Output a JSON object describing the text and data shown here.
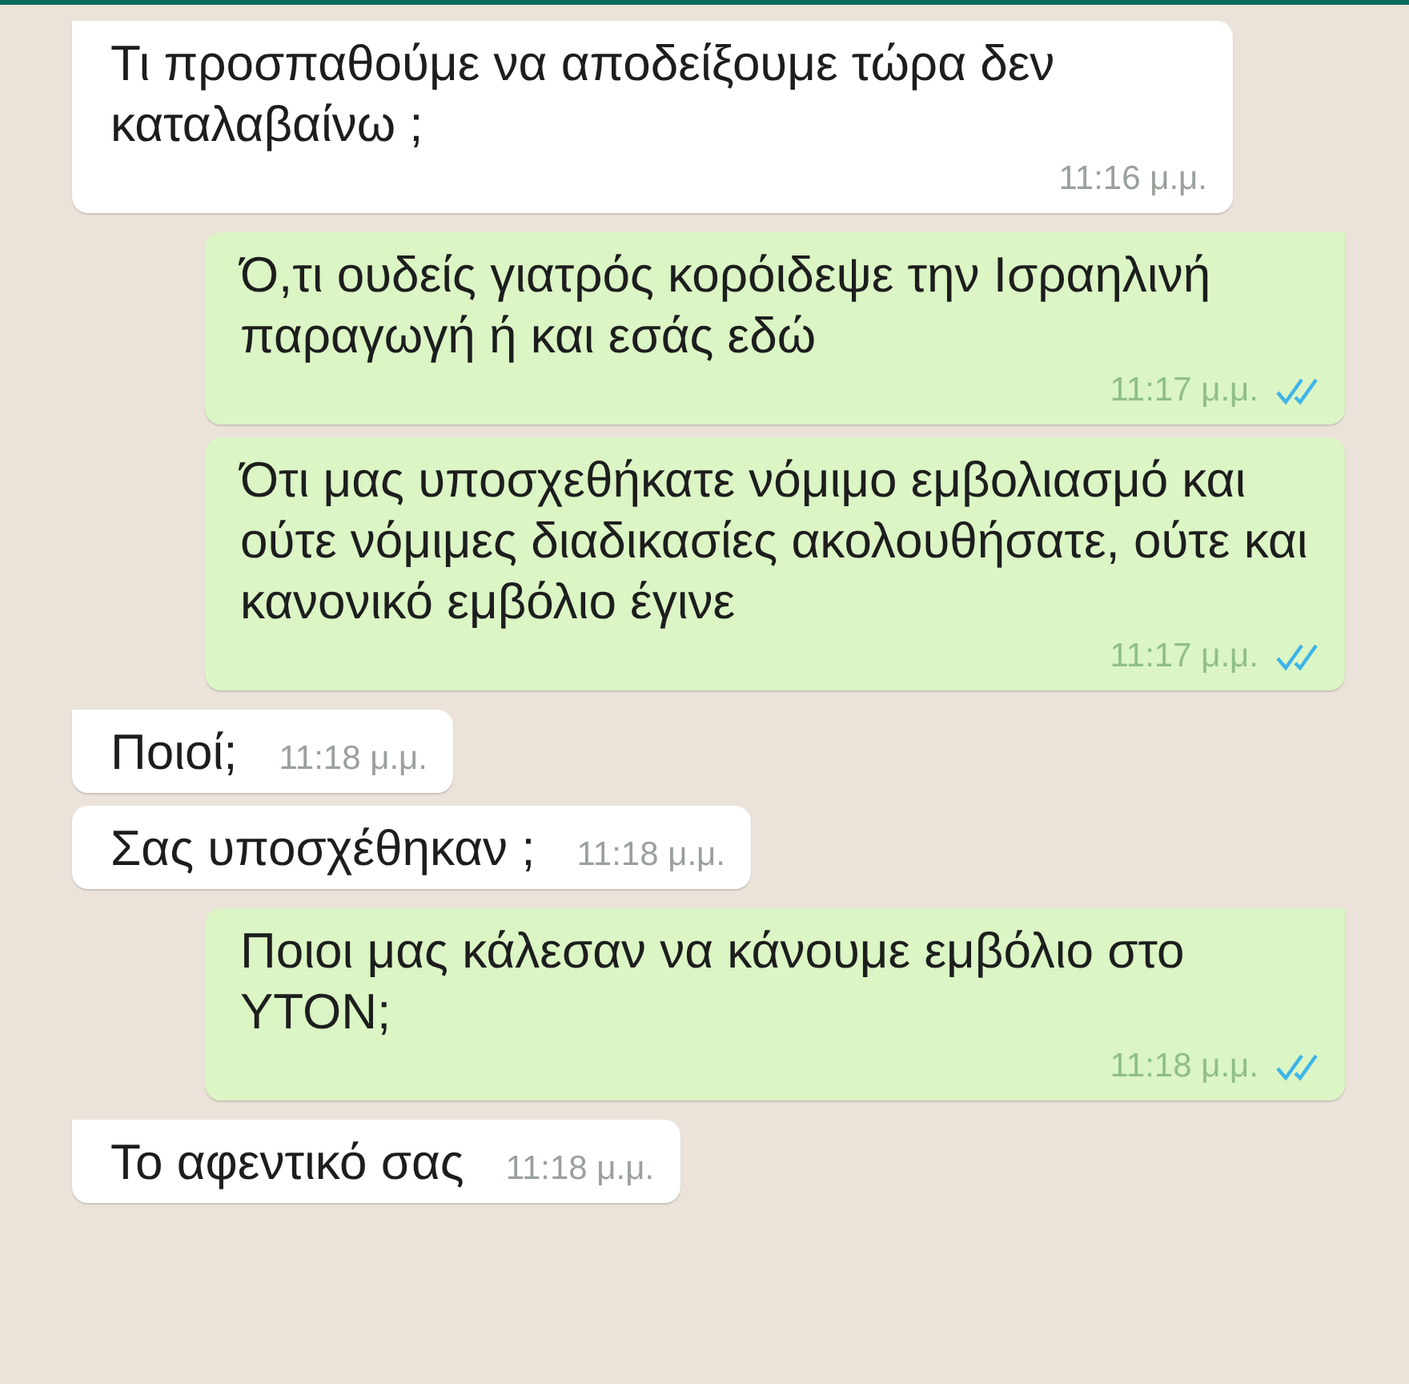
{
  "messages": [
    {
      "kind": "incoming",
      "tail": true,
      "text": "Τι προσπαθούμε να αποδείξουμε τώρα δεν καταλαβαίνω ;",
      "time": "11:16 μ.μ."
    },
    {
      "kind": "outgoing",
      "tail": true,
      "text": "Ό,τι ουδείς γιατρός κορόιδεψε την Ισραηλινή παραγωγή ή και εσάς εδώ",
      "time": "11:17 μ.μ.",
      "read": true
    },
    {
      "kind": "outgoing",
      "tail": false,
      "text": "Ότι μας υποσχεθήκατε νόμιμο εμβολιασμό και ούτε νόμιμες διαδικασίες ακολουθήσατε, ούτε και κανονικό εμβόλιο έγινε",
      "time": "11:17 μ.μ.",
      "read": true
    },
    {
      "kind": "incoming",
      "tail": true,
      "text": "Ποιοί;",
      "time": "11:18 μ.μ."
    },
    {
      "kind": "incoming",
      "tail": false,
      "text": "Σας υποσχέθηκαν ;",
      "time": "11:18 μ.μ."
    },
    {
      "kind": "outgoing",
      "tail": true,
      "text": "Ποιοι μας κάλεσαν να κάνουμε εμβόλιο στο ΥΤΟΝ;",
      "time": "11:18 μ.μ.",
      "read": true
    },
    {
      "kind": "incoming",
      "tail": true,
      "text": "Το αφεντικό σας",
      "time": "11:18 μ.μ."
    }
  ]
}
